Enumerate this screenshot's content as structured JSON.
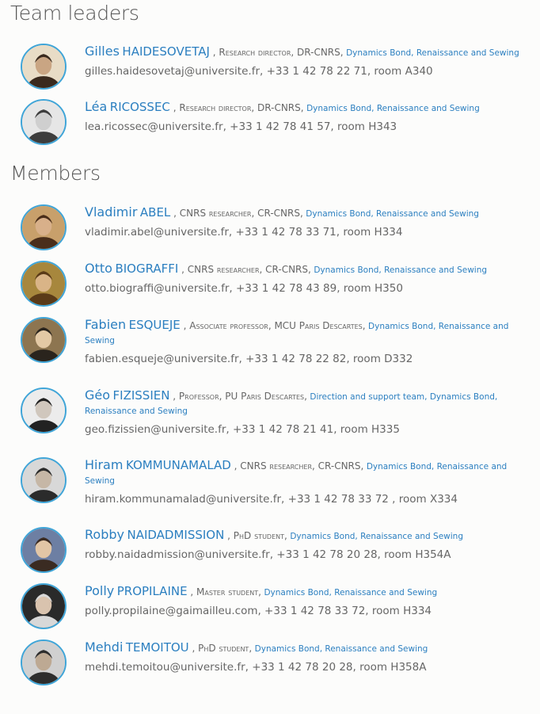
{
  "sections": [
    {
      "title": "Team leaders"
    },
    {
      "title": "Members"
    }
  ],
  "people": [
    {
      "first": "Gilles",
      "last": "HAIDESOVETAJ",
      "position": "Research director, DR-CNRS,",
      "teams": "Dynamics Bond, Renaissance and Sewing",
      "contact": "gilles.haidesovetaj@universite.fr, +33 1 42 78 22 71, room A340"
    },
    {
      "first": "Léa",
      "last": "RICOSSEC",
      "position": "Research director, DR-CNRS,",
      "teams": "Dynamics Bond, Renaissance and Sewing",
      "contact": "lea.ricossec@universite.fr, +33 1 42 78 41 57, room H343"
    },
    {
      "first": "Vladimir",
      "last": "ABEL",
      "position": "CNRS researcher, CR-CNRS,",
      "teams": "Dynamics Bond, Renaissance and Sewing",
      "contact": "vladimir.abel@universite.fr, +33 1 42 78 33 71, room H334"
    },
    {
      "first": "Otto",
      "last": "BIOGRAFFI",
      "position": "CNRS researcher, CR-CNRS,",
      "teams": "Dynamics Bond, Renaissance and Sewing",
      "contact": "otto.biograffi@universite.fr, +33 1 42 78 43 89, room H350"
    },
    {
      "first": "Fabien",
      "last": "ESQUEJE",
      "position": "Associate professor, MCU Paris Descartes,",
      "teams": "Dynamics Bond, Renaissance and Sewing",
      "contact": "fabien.esqueje@universite.fr, +33 1 42 78 22 82, room D332"
    },
    {
      "first": "Géo",
      "last": "FIZISSIEN",
      "position": "Professor, PU Paris Descartes,",
      "teams": "Direction and support team, Dynamics Bond, Renaissance and Sewing",
      "contact": "geo.fizissien@universite.fr, +33 1 42 78 21 41, room H335"
    },
    {
      "first": "Hiram",
      "last": "KOMMUNAMALAD",
      "position": "CNRS researcher, CR-CNRS,",
      "teams": "Dynamics Bond, Renaissance and Sewing",
      "contact": "hiram.kommunamalad@universite.fr, +33 1 42 78 33 72 , room X334"
    },
    {
      "first": "Robby",
      "last": "NAIDADMISSION",
      "position": "PhD student,",
      "teams": "Dynamics Bond, Renaissance and Sewing",
      "contact": "robby.naidadmission@universite.fr, +33 1 42 78 20 28, room H354A"
    },
    {
      "first": "Polly",
      "last": "PROPILAINE",
      "position": "Master student,",
      "teams": "Dynamics Bond, Renaissance and Sewing",
      "contact": "polly.propilaine@gaimailleu.com, +33 1 42 78 33 72, room H334"
    },
    {
      "first": "Mehdi",
      "last": "TEMOITOU",
      "position": "PhD student,",
      "teams": "Dynamics Bond, Renaissance and Sewing",
      "contact": "mehdi.temoitou@universite.fr, +33 1 42 78 20 28, room H358A"
    }
  ],
  "colors": {
    "link": "#2b7fc0",
    "avatar_border": "#3fa5d8",
    "text": "#666666"
  },
  "icons": {
    "avatar": "portrait-photo"
  }
}
